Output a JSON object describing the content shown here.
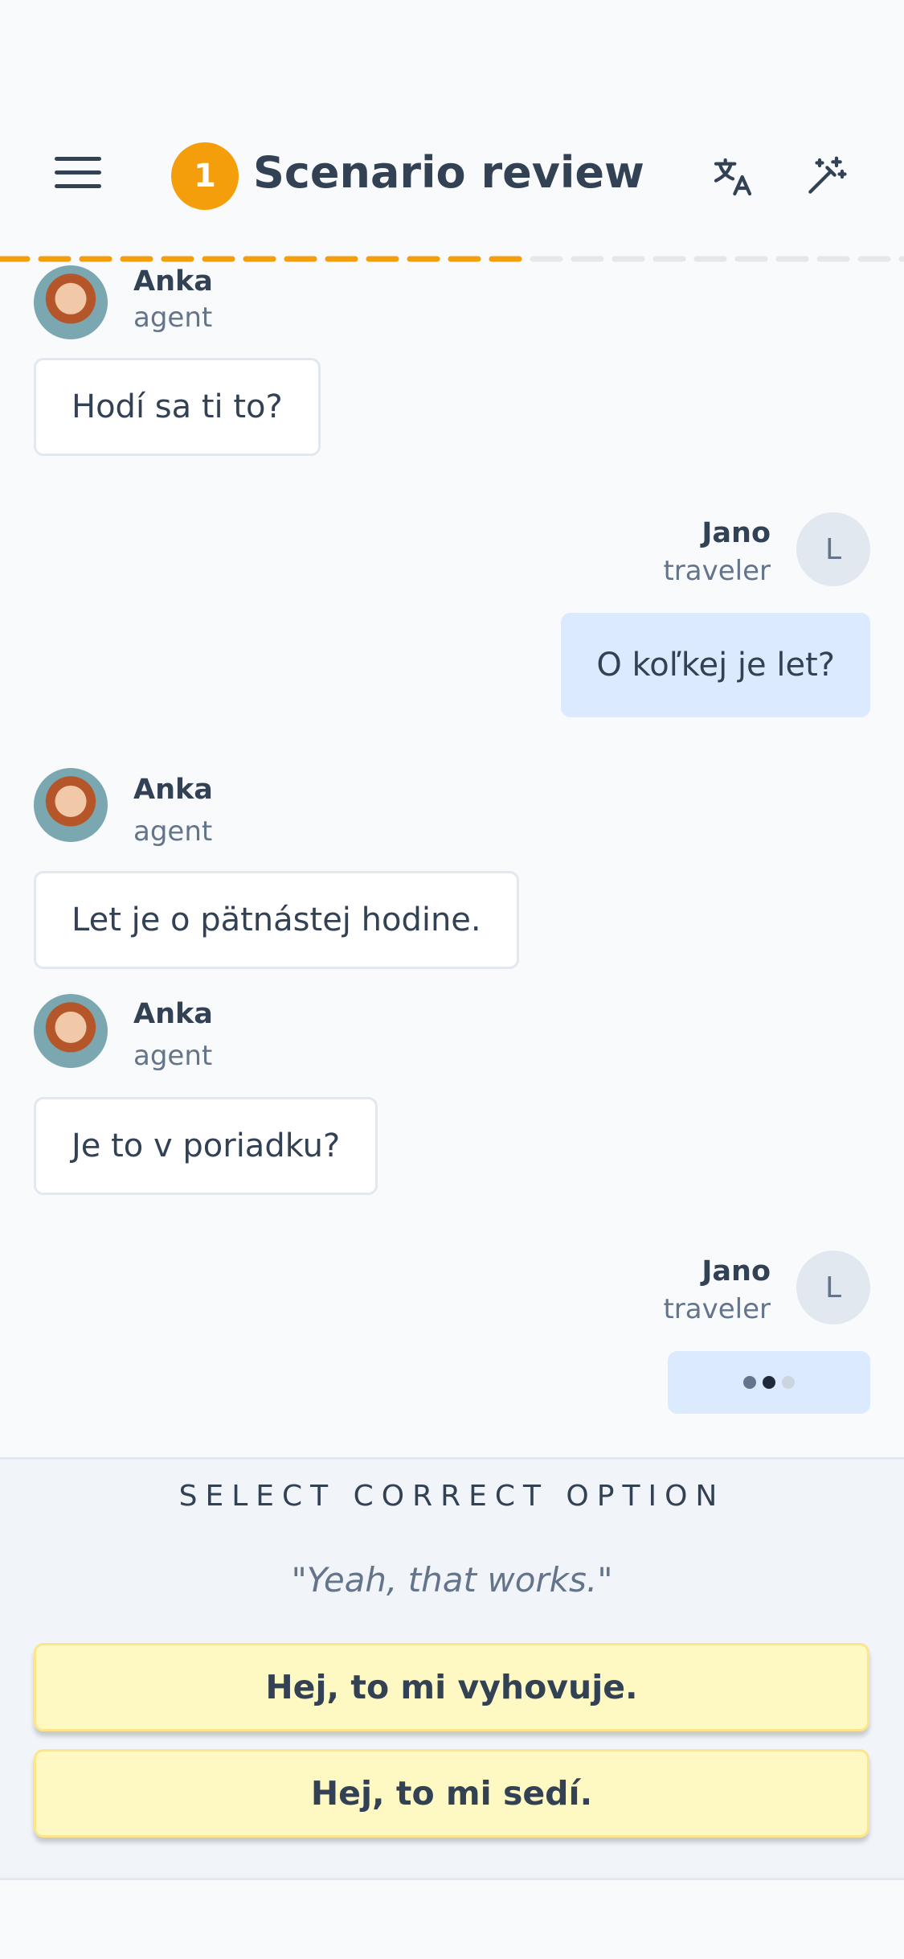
{
  "header": {
    "step_number": "1",
    "title": "Scenario review",
    "icons": {
      "menu": "menu-icon",
      "translate": "translate-icon",
      "magic": "magic-wand-icon"
    },
    "progress_fraction": 0.58
  },
  "colors": {
    "accent": "#f59e0b",
    "progress_empty": "#e5e7eb",
    "agent_bubble": "#ffffff",
    "user_bubble": "#dbeafe",
    "option_bg": "#fef9c3",
    "text": "#334155",
    "muted": "#64748b"
  },
  "messages": [
    {
      "sender": "Anka",
      "role": "agent",
      "text": "Hodí sa ti to?"
    },
    {
      "sender": "Jano",
      "role": "traveler",
      "avatar_letter": "L",
      "text": "O koľkej je let?"
    },
    {
      "sender": "Anka",
      "role": "agent",
      "text": "Let je o pätnástej hodine."
    },
    {
      "sender": "Anka",
      "role": "agent",
      "text": "Je to v poriadku?"
    },
    {
      "sender": "Jano",
      "role": "traveler",
      "avatar_letter": "L",
      "typing": true
    }
  ],
  "quiz": {
    "label": "SELECT CORRECT OPTION",
    "prompt": "\"Yeah, that works.\"",
    "options": [
      "Hej, to mi vyhovuje.",
      "Hej, to mi sedí."
    ]
  }
}
